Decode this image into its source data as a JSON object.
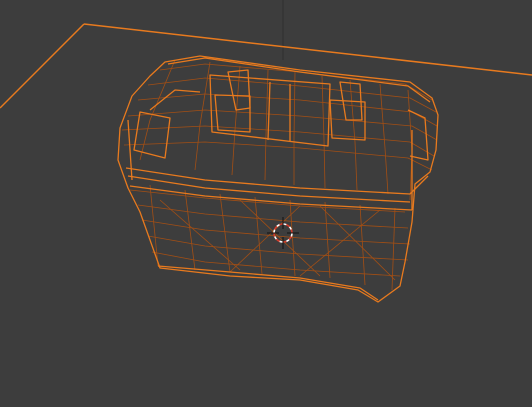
{
  "viewport": {
    "mode": "wireframe",
    "background_color": "#3d3d3d",
    "selection_color": "#e87a1e",
    "selection_dim_color": "#b4520e",
    "grid_axis_color": "#2e2e2e",
    "selected_object": "chest-mesh",
    "selection_state": "selected",
    "cursor_icon": "3d-cursor-icon"
  }
}
